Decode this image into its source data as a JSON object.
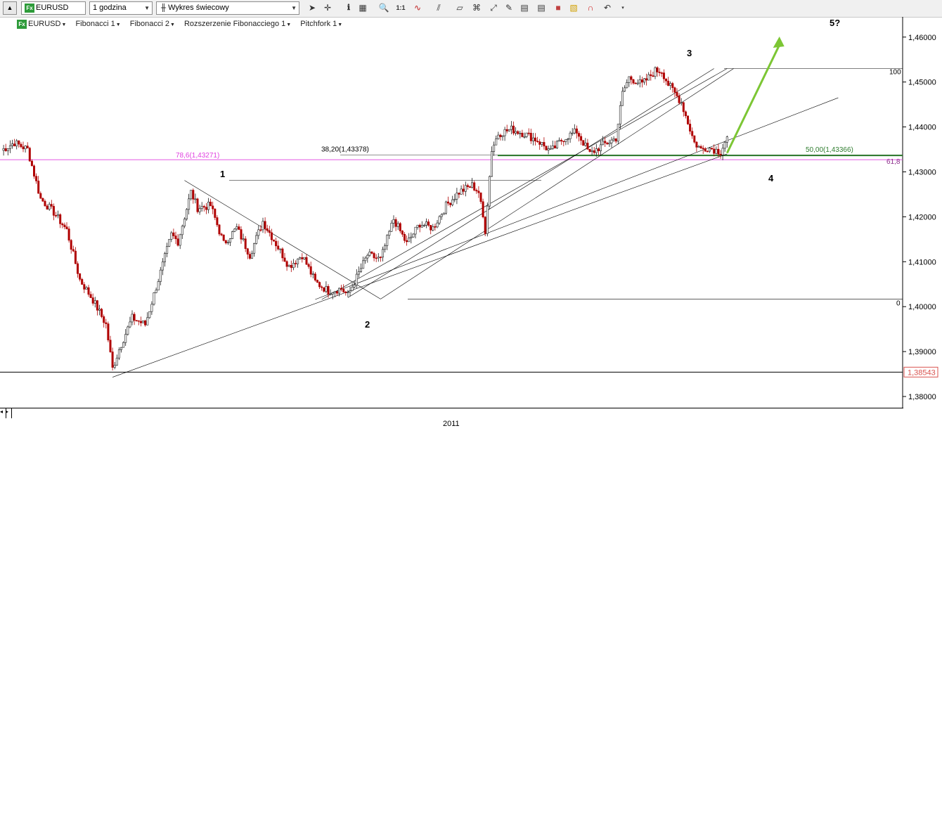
{
  "toolbar": {
    "symbol_value": "EURUSD",
    "interval_value": "1 godzina",
    "chart_type_value": "Wykres świecowy",
    "fx_badge": "Fx",
    "icons": [
      "collapse-up-icon",
      "cursor-icon",
      "crosshair-icon",
      "info-icon",
      "grid-icon",
      "zoom-icon",
      "one-to-one-icon",
      "indicators-icon",
      "trendline-icon",
      "channel-icon",
      "fibonacci-icon",
      "drawing-tools-icon",
      "save-template-icon",
      "color-icon",
      "alert-icon",
      "magnet-icon",
      "undo-icon",
      "more-icon"
    ]
  },
  "legend": {
    "symbol": "EURUSD",
    "studies": [
      "Fibonacci 1",
      "Fibonacci 2",
      "Rozszerzenie Fibonacciego 1",
      "Pitchfork 1"
    ]
  },
  "colors": {
    "bull": "#1a1a1a",
    "bear": "#b00000",
    "fib_magenta": "#e040e0",
    "fib_green": "#2f7d2f",
    "arrow_green": "#7cc634",
    "price_badge": "#d9534f"
  },
  "chart_data": {
    "type": "candlestick",
    "symbol": "EURUSD",
    "interval": "1 godzina",
    "ylim": [
      1.3775,
      1.4645
    ],
    "yticks": [
      "1,38000",
      "1,39000",
      "1,40000",
      "1,41000",
      "1,42000",
      "1,43000",
      "1,44000",
      "1,45000",
      "1,46000"
    ],
    "x_label": "2011",
    "current_price": "1,38543",
    "wave_labels": [
      "1",
      "2",
      "3",
      "4",
      "5?"
    ],
    "fib_labels": {
      "retr_78_6": "78,6(1,43271)",
      "retr_38_2": "38,20(1,43378)",
      "retr_50": "50,00(1,43366)",
      "level_100": "100",
      "level_61_8": "61,8",
      "level_0": "0"
    },
    "levels": {
      "retr_78_6": 1.43271,
      "retr_38_2": 1.43378,
      "retr_50": 1.43366,
      "fib_100": 1.453,
      "fib_0": 1.4017,
      "wave1_high": 1.4281,
      "current": 1.38543
    },
    "close_path": [
      [
        0,
        1.4348
      ],
      [
        2,
        1.4365
      ],
      [
        4,
        1.435
      ],
      [
        6,
        1.424
      ],
      [
        8,
        1.421
      ],
      [
        10,
        1.417
      ],
      [
        12,
        1.406
      ],
      [
        14,
        1.4015
      ],
      [
        16,
        1.396
      ],
      [
        17,
        1.3862
      ],
      [
        18,
        1.3905
      ],
      [
        20,
        1.3975
      ],
      [
        22,
        1.396
      ],
      [
        24,
        1.406
      ],
      [
        26,
        1.416
      ],
      [
        27,
        1.4145
      ],
      [
        29,
        1.4255
      ],
      [
        30,
        1.422
      ],
      [
        32,
        1.4225
      ],
      [
        34,
        1.414
      ],
      [
        36,
        1.4175
      ],
      [
        38,
        1.4115
      ],
      [
        40,
        1.419
      ],
      [
        42,
        1.414
      ],
      [
        44,
        1.409
      ],
      [
        46,
        1.4115
      ],
      [
        48,
        1.4055
      ],
      [
        50,
        1.4035
      ],
      [
        52,
        1.404
      ],
      [
        53,
        1.4025
      ],
      [
        54,
        1.4055
      ],
      [
        56,
        1.4115
      ],
      [
        58,
        1.4105
      ],
      [
        60,
        1.4195
      ],
      [
        62,
        1.414
      ],
      [
        64,
        1.4185
      ],
      [
        66,
        1.4175
      ],
      [
        68,
        1.4225
      ],
      [
        70,
        1.4255
      ],
      [
        72,
        1.427
      ],
      [
        73,
        1.4255
      ],
      [
        74,
        1.417
      ],
      [
        75,
        1.435
      ],
      [
        76,
        1.4385
      ],
      [
        78,
        1.4395
      ],
      [
        80,
        1.4385
      ],
      [
        82,
        1.437
      ],
      [
        84,
        1.4345
      ],
      [
        86,
        1.4375
      ],
      [
        88,
        1.439
      ],
      [
        90,
        1.434
      ],
      [
        92,
        1.436
      ],
      [
        94,
        1.4375
      ],
      [
        95,
        1.4475
      ],
      [
        96,
        1.451
      ],
      [
        98,
        1.4495
      ],
      [
        100,
        1.4525
      ],
      [
        101,
        1.4525
      ],
      [
        102,
        1.4495
      ],
      [
        104,
        1.4455
      ],
      [
        106,
        1.4365
      ],
      [
        107,
        1.435
      ],
      [
        108,
        1.4355
      ],
      [
        110,
        1.4345
      ],
      [
        111,
        1.4378
      ]
    ],
    "lines": [
      {
        "from": [
          17,
          1.3843
        ],
        "to": [
          111,
          1.434
        ]
      },
      {
        "from": [
          49,
          1.4016
        ],
        "to": [
          111,
          1.453
        ]
      },
      {
        "from": [
          53,
          1.402
        ],
        "to": [
          109,
          1.453
        ]
      },
      {
        "from": [
          58,
          1.4017
        ],
        "to": [
          112,
          1.453
        ]
      },
      {
        "from": [
          28,
          1.4281
        ],
        "to": [
          58,
          1.4017
        ]
      },
      {
        "from": [
          48,
          1.4016
        ],
        "to": [
          128,
          1.4465
        ]
      }
    ],
    "forecast_arrow": {
      "from": [
        111,
        1.4342
      ],
      "to": [
        119,
        1.4595
      ]
    }
  }
}
